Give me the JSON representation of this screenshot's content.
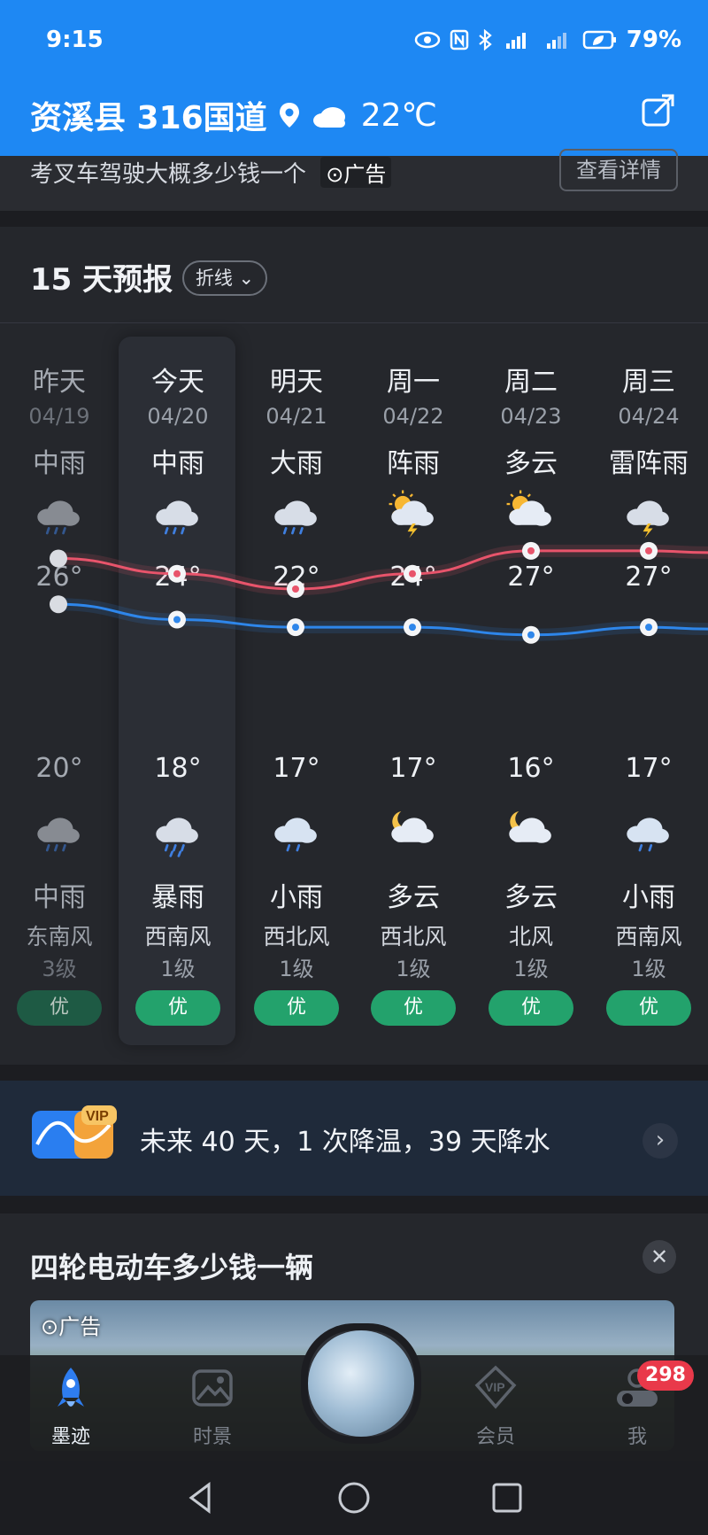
{
  "status_bar": {
    "time": "9:15",
    "battery": "79%"
  },
  "header": {
    "location": "资溪县 316国道",
    "weather_icon": "cloudy-icon",
    "temperature": "22℃"
  },
  "ad_bar": {
    "text": "考叉车驾驶大概多少钱一个",
    "tag": "广告",
    "detail_button": "查看详情"
  },
  "forecast": {
    "title": "15 天预报",
    "toggle": "折线",
    "days": [
      {
        "day": "昨天",
        "date": "04/19",
        "cond_day": "中雨",
        "icon_day": "rain-icon",
        "high": "26°",
        "low": "20°",
        "icon_night": "rain-icon",
        "cond_night": "中雨",
        "wind_dir": "东南风",
        "wind_level": "3级",
        "aqi": "优"
      },
      {
        "day": "今天",
        "date": "04/20",
        "cond_day": "中雨",
        "icon_day": "rain-icon",
        "high": "24°",
        "low": "18°",
        "icon_night": "heavy-rain-icon",
        "cond_night": "暴雨",
        "wind_dir": "西南风",
        "wind_level": "1级",
        "aqi": "优"
      },
      {
        "day": "明天",
        "date": "04/21",
        "cond_day": "大雨",
        "icon_day": "rain-icon",
        "high": "22°",
        "low": "17°",
        "icon_night": "light-rain-icon",
        "cond_night": "小雨",
        "wind_dir": "西北风",
        "wind_level": "1级",
        "aqi": "优"
      },
      {
        "day": "周一",
        "date": "04/22",
        "cond_day": "阵雨",
        "icon_day": "sun-thunder-rain-icon",
        "high": "24°",
        "low": "17°",
        "icon_night": "moon-cloud-icon",
        "cond_night": "多云",
        "wind_dir": "西北风",
        "wind_level": "1级",
        "aqi": "优"
      },
      {
        "day": "周二",
        "date": "04/23",
        "cond_day": "多云",
        "icon_day": "sun-cloud-icon",
        "high": "27°",
        "low": "16°",
        "icon_night": "moon-cloud-icon",
        "cond_night": "多云",
        "wind_dir": "北风",
        "wind_level": "1级",
        "aqi": "优"
      },
      {
        "day": "周三",
        "date": "04/24",
        "cond_day": "雷阵雨",
        "icon_day": "thunderstorm-icon",
        "high": "27°",
        "low": "17°",
        "icon_night": "light-rain-icon",
        "cond_night": "小雨",
        "wind_dir": "西南风",
        "wind_level": "1级",
        "aqi": "优"
      }
    ],
    "highs": [
      26,
      24,
      22,
      24,
      27,
      27
    ],
    "lows": [
      20,
      18,
      17,
      17,
      16,
      17
    ],
    "high_color": "#e8546b",
    "low_color": "#2e86ea",
    "aqi_color": "#23a26c"
  },
  "promo": {
    "badge": "VIP",
    "text": "未来 40 天，1 次降温，39 天降水"
  },
  "news": {
    "headline": "四轮电动车多少钱一辆",
    "ad_tag": "广告"
  },
  "bottom_nav": {
    "tabs": [
      {
        "label": "墨迹",
        "icon": "rocket-icon"
      },
      {
        "label": "时景",
        "icon": "photo-icon"
      },
      {
        "label": "会员",
        "icon": "vip-diamond-icon"
      },
      {
        "label": "我",
        "icon": "profile-toggle-icon"
      }
    ],
    "badge_count": "298"
  }
}
